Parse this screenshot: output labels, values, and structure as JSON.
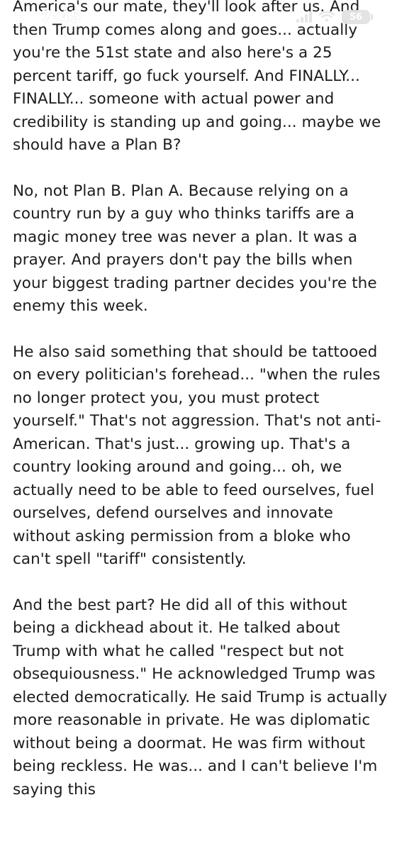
{
  "status_bar": {
    "time": "7:45",
    "battery_level": "56",
    "icons": [
      "cellular-signal-icon",
      "wifi-icon",
      "battery-icon"
    ]
  },
  "article": {
    "paragraphs": [
      "America's our mate, they'll look after us. And then Trump comes along and goes... actually you're the 51st state and also here's a 25 percent tariff, go fuck yourself. And FINALLY... FINALLY... someone with actual power and credibility is standing up and going... maybe we should have a Plan B?",
      "No, not Plan B. Plan A. Because relying on a country run by a guy who thinks tariffs are a magic money tree was never a plan. It was a prayer. And prayers don't pay the bills when your biggest trading partner decides you're the enemy this week.",
      "He also said something that should be tattooed on every politician's forehead... \"when the rules no longer protect you, you must protect yourself.\" That's not aggression. That's not anti-American. That's just... growing up. That's a country looking around and going... oh, we actually need to be able to feed ourselves, fuel ourselves, defend ourselves and innovate without asking permission from a bloke who can't spell \"tariff\" consistently.",
      "And the best part? He did all of this without being a dickhead about it. He talked about Trump with what he called \"respect but not obsequiousness.\" He acknowledged Trump was elected democratically. He said Trump is actually more reasonable in private. He was diplomatic without being a doormat. He was firm without being reckless. He was... and I can't believe I'm saying this"
    ]
  }
}
